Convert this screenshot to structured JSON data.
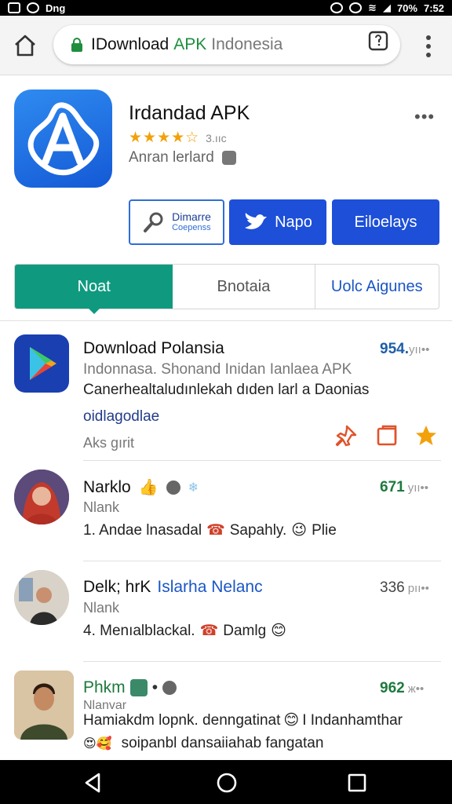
{
  "status_bar": {
    "left_text": "Dng",
    "battery": "70%",
    "time": "7:52"
  },
  "browser": {
    "url_part1": "IDownload",
    "url_part2": "APK",
    "url_part3": "Indonesia"
  },
  "app": {
    "title": "Irdandad APK",
    "rating_stars": "★★★★☆",
    "rating_value": 4,
    "rating_count": "3.ııc",
    "developer": "Anran lerlard",
    "more": "•••",
    "buttons": {
      "outline_line1": "Dimarre",
      "outline_line2": "Coepenss",
      "blue1": "Napo",
      "blue2": "Eiloelays"
    }
  },
  "tabs": [
    "Noat",
    "Bnotaia",
    "Uolc Aigunes"
  ],
  "feature": {
    "title": "Download Polansia",
    "count": "954.",
    "count_suffix": "yıı••",
    "line1": "Indonnasa. Shonand Inidan Ianlaea APK",
    "line2": "Canerhealtaludınlekah dıden larl a Daonias",
    "line3": "oidlagodlae",
    "meta": "Aks gırit"
  },
  "comments": [
    {
      "name": "Narklo",
      "sub": "Nlank",
      "body": "1. Andae lnasadal",
      "body_emoji1": "Sapahly.",
      "body_tail": "Plie",
      "count": "671",
      "suffix": "yıı••"
    },
    {
      "name": "Delk; hrK",
      "name_blue": "Islarha Nelanc",
      "sub": "Nlank",
      "body": "4. Menıalblackal.",
      "body_tail": "Damlg",
      "count": "336",
      "suffix": "pıı••"
    },
    {
      "name": "Phkm",
      "sub": "Nlanvar",
      "body": "Hamiakdm lopnk. denngatinat",
      "body_tail": "I Indanhamthar",
      "body2": "soipanbl dansaiiahab fangatan",
      "count": "962",
      "suffix": "ж••"
    }
  ],
  "colors": {
    "teal": "#0f9a80",
    "blue": "#1d4fd8",
    "green_count": "#1e7a3e",
    "orange": "#e0532a",
    "star": "#f2a10b"
  }
}
